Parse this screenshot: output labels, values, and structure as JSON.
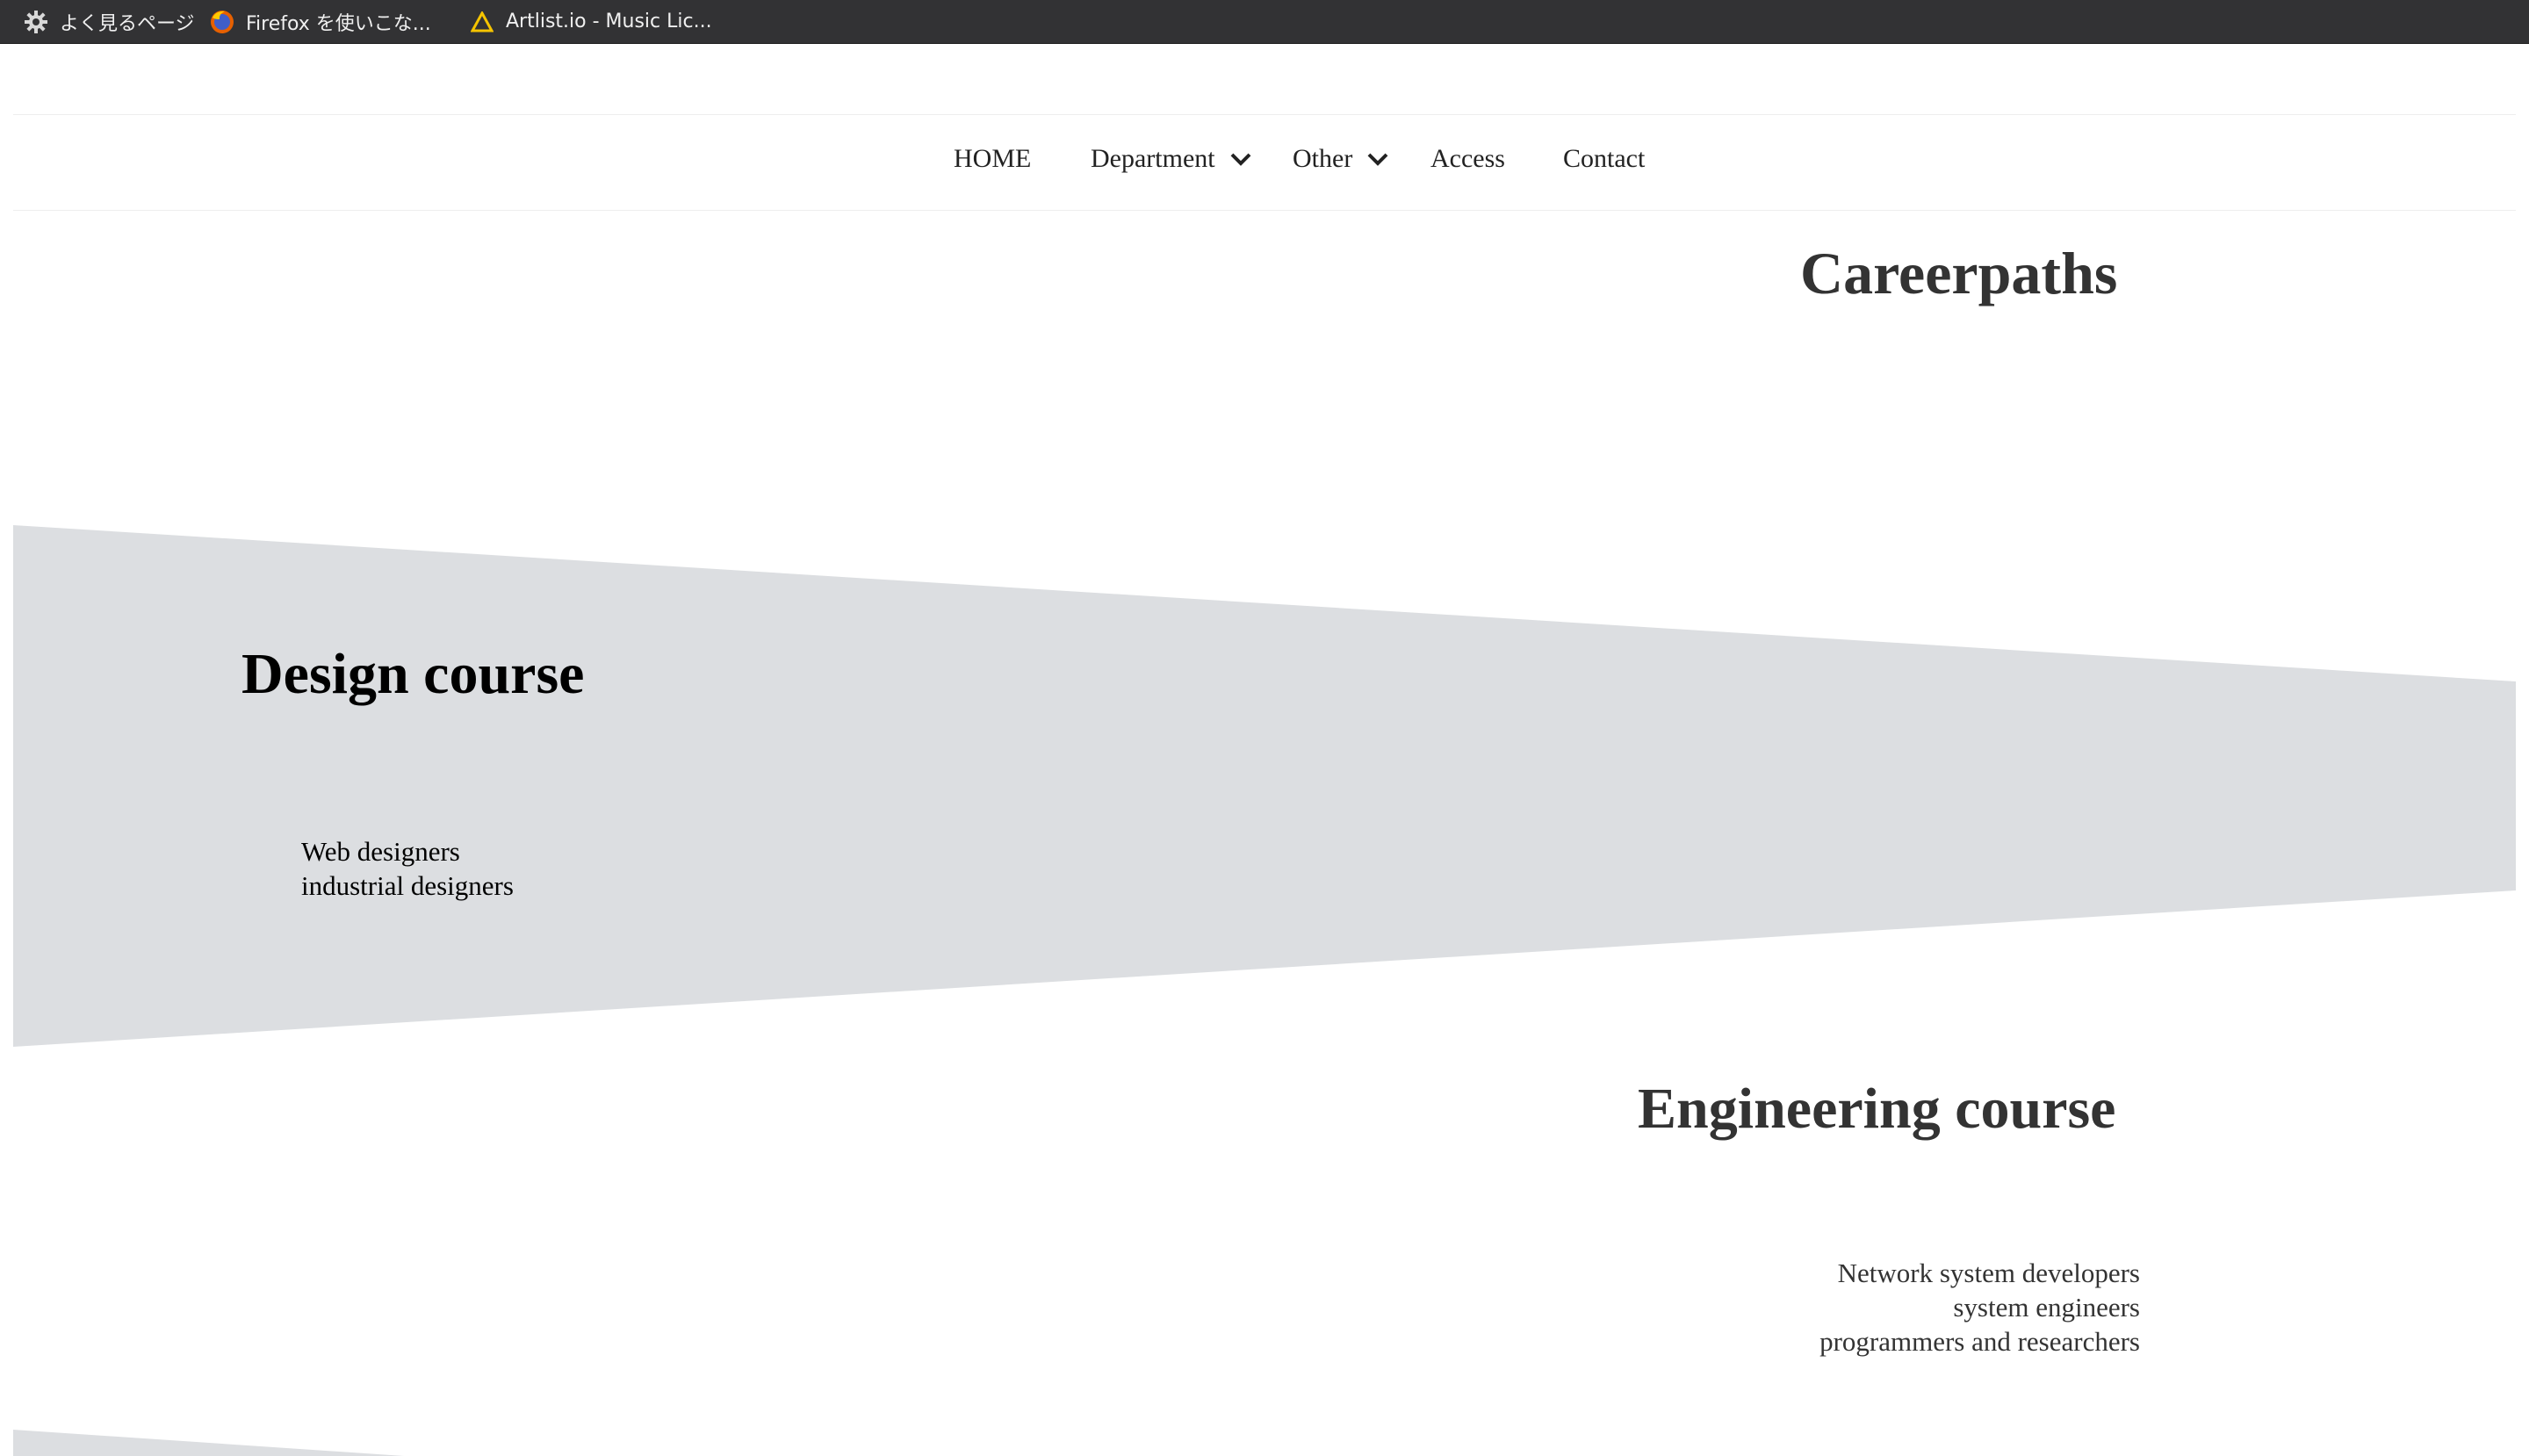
{
  "bookmarks": {
    "items": [
      {
        "label": "よく見るページ",
        "icon": "gear-icon"
      },
      {
        "label": "Firefox を使いこな...",
        "icon": "firefox-icon"
      },
      {
        "label": "Artlist.io - Music Lic...",
        "icon": "artlist-icon"
      }
    ]
  },
  "nav": {
    "items": [
      {
        "label": "HOME"
      },
      {
        "label": "Department",
        "icon": "chevron-down-icon"
      },
      {
        "label": "Other",
        "icon": "chevron-down-icon"
      },
      {
        "label": "Access"
      },
      {
        "label": "Contact"
      }
    ]
  },
  "page": {
    "title": "Careerpaths",
    "band_color": "#dcdee1"
  },
  "courses": [
    {
      "title": "Design course",
      "careers": [
        "Web designers",
        "industrial designers"
      ]
    },
    {
      "title": "Engineering course",
      "careers": [
        "Network system developers",
        "system engineers",
        "programmers and researchers"
      ]
    }
  ]
}
